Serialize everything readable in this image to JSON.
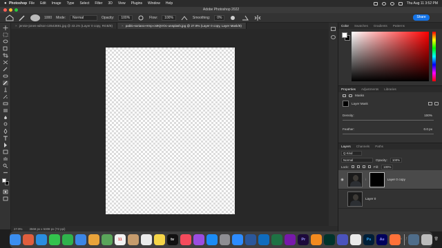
{
  "menubar": {
    "app_name": "Photoshop",
    "items": [
      "File",
      "Edit",
      "Image",
      "Type",
      "Select",
      "Filter",
      "3D",
      "View",
      "Plugins",
      "Window",
      "Help"
    ],
    "clock": "Thu Aug 11 3:52 PM"
  },
  "window": {
    "title": "Adobe Photoshop 2022"
  },
  "options": {
    "brush_size": "1000",
    "mode_label": "Mode:",
    "mode_value": "Normal",
    "opacity_label": "Opacity:",
    "opacity_value": "100%",
    "flow_label": "Flow:",
    "flow_value": "100%",
    "smoothing_label": "Smoothing:",
    "smoothing_value": "0%",
    "share_label": "Share"
  },
  "tabs": [
    {
      "label": "jennie-jones-wilson-10543691.jpg @ 43.1% (Layer 0 copy, RGB/8)",
      "active": false
    },
    {
      "label": "pablo-soriano-Hmp-cs9QVOc-unsplash.jpg @ 27.9% (Layer 0 copy, Layer Mask/8)",
      "active": true
    }
  ],
  "status": {
    "zoom": "27.9%",
    "doc_info": "3568 px x 5308 px (72 ppi)"
  },
  "color_panel": {
    "tabs": [
      "Color",
      "Swatches",
      "Gradients",
      "Patterns"
    ],
    "active": "Color"
  },
  "properties_panel": {
    "tabs": [
      "Properties",
      "Adjustments",
      "Libraries"
    ],
    "active": "Properties",
    "masks_label": "Masks",
    "layer_mask_label": "Layer Mask",
    "density_label": "Density:",
    "density_value": "100%",
    "feather_label": "Feather:",
    "feather_value": "0.0 px"
  },
  "layers_panel": {
    "tabs": [
      "Layers",
      "Channels",
      "Paths"
    ],
    "active": "Layers",
    "kind_label": "Q Kind",
    "blend_mode": "Normal",
    "opacity_label": "Opacity:",
    "opacity_value": "100%",
    "lock_label": "Lock:",
    "fill_label": "Fill:",
    "fill_value": "100%",
    "layers": [
      {
        "name": "Layer 0 copy",
        "selected": true,
        "visible": true
      },
      {
        "name": "Layer 0",
        "selected": false,
        "visible": false
      }
    ]
  },
  "dock": {
    "apps": [
      {
        "name": "finder",
        "color": "#3b8ef0"
      },
      {
        "name": "launchpad",
        "color": "#e05e3d"
      },
      {
        "name": "safari",
        "color": "#2a8de0"
      },
      {
        "name": "messages",
        "color": "#33c24d"
      },
      {
        "name": "facetime",
        "color": "#2fb24c"
      },
      {
        "name": "mail",
        "color": "#3c86e6"
      },
      {
        "name": "photos",
        "color": "#e9a33a"
      },
      {
        "name": "maps",
        "color": "#5aa55a"
      },
      {
        "name": "calendar",
        "color": "#f2f2f2"
      },
      {
        "name": "contacts",
        "color": "#c69c6d"
      },
      {
        "name": "reminders",
        "color": "#eaeaea"
      },
      {
        "name": "notes",
        "color": "#f5d548"
      },
      {
        "name": "tv",
        "color": "#111111"
      },
      {
        "name": "music",
        "color": "#f44b5c"
      },
      {
        "name": "podcasts",
        "color": "#9b4de0"
      },
      {
        "name": "app-store",
        "color": "#1b8cf5"
      },
      {
        "name": "settings",
        "color": "#8e8e93"
      },
      {
        "name": "zoom",
        "color": "#2d8cff"
      },
      {
        "name": "word",
        "color": "#2b579a"
      },
      {
        "name": "outlook",
        "color": "#0f6cbd"
      },
      {
        "name": "excel",
        "color": "#1f7244"
      },
      {
        "name": "onenote",
        "color": "#7719aa"
      },
      {
        "name": "premiere",
        "color": "#1d0a3b"
      },
      {
        "name": "vlc",
        "color": "#f28a1f"
      },
      {
        "name": "audition",
        "color": "#00332b"
      },
      {
        "name": "teams",
        "color": "#4b53bc"
      },
      {
        "name": "chrome",
        "color": "#e9e9e9"
      },
      {
        "name": "photoshop",
        "color": "#001e36"
      },
      {
        "name": "after-effects",
        "color": "#00005b"
      },
      {
        "name": "firefox",
        "color": "#ff7139"
      },
      {
        "name": "downloads",
        "color": "#4f6d8a"
      },
      {
        "name": "trash",
        "color": "#bcbcbc"
      }
    ],
    "badges": {
      "premiere": "Pr",
      "photoshop": "Ps",
      "after-effects": "Ae",
      "tv": "tv",
      "calendar": "11"
    }
  }
}
